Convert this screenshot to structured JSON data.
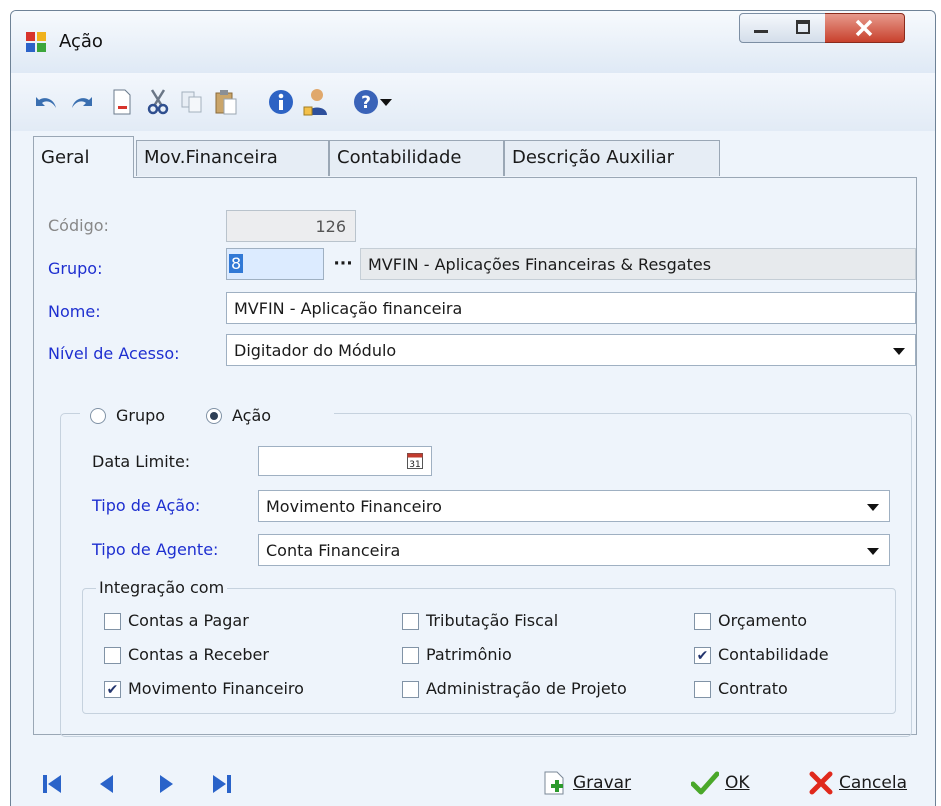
{
  "window": {
    "title": "Ação"
  },
  "toolbar": {
    "icons": [
      "undo-icon",
      "redo-icon",
      "new-document-icon",
      "cut-icon",
      "copy-icon",
      "paste-icon",
      "info-icon",
      "user-icon",
      "help-icon",
      "dropdown-arrow-icon"
    ]
  },
  "tabs": [
    {
      "label": "Geral",
      "active": true
    },
    {
      "label": "Mov.Financeira",
      "active": false
    },
    {
      "label": "Contabilidade",
      "active": false
    },
    {
      "label": "Descrição Auxiliar",
      "active": false
    }
  ],
  "form": {
    "codigo_label": "Código:",
    "codigo_value": "126",
    "grupo_label": "Grupo:",
    "grupo_value": "8",
    "grupo_lookup_button": "···",
    "grupo_description": "MVFIN - Aplicações Financeiras & Resgates",
    "nome_label": "Nome:",
    "nome_value": "MVFIN - Aplicação financeira",
    "nivel_label": "Nível de Acesso:",
    "nivel_value": "Digitador do Módulo"
  },
  "scope": {
    "option_grupo": "Grupo",
    "option_acao": "Ação",
    "selected": "Ação",
    "data_limite_label": "Data Limite:",
    "data_limite_value": "",
    "tipo_acao_label": "Tipo de Ação:",
    "tipo_acao_value": "Movimento Financeiro",
    "tipo_agente_label": "Tipo de Agente:",
    "tipo_agente_value": "Conta Financeira"
  },
  "integracao": {
    "title": "Integração com",
    "items": [
      {
        "label": "Contas a Pagar",
        "checked": false
      },
      {
        "label": "Contas a Receber",
        "checked": false
      },
      {
        "label": "Movimento Financeiro",
        "checked": true
      },
      {
        "label": "Tributação Fiscal",
        "checked": false
      },
      {
        "label": "Patrimônio",
        "checked": false
      },
      {
        "label": "Administração de Projeto",
        "checked": false
      },
      {
        "label": "Orçamento",
        "checked": false
      },
      {
        "label": "Contabilidade",
        "checked": true
      },
      {
        "label": "Contrato",
        "checked": false
      }
    ]
  },
  "footer": {
    "gravar_label": "Gravar",
    "ok_label": "OK",
    "cancela_label": "Cancela"
  },
  "colors": {
    "required_label": "#1e2fd0",
    "disabled_label": "#888888",
    "window_bg": "#eef4fb"
  }
}
